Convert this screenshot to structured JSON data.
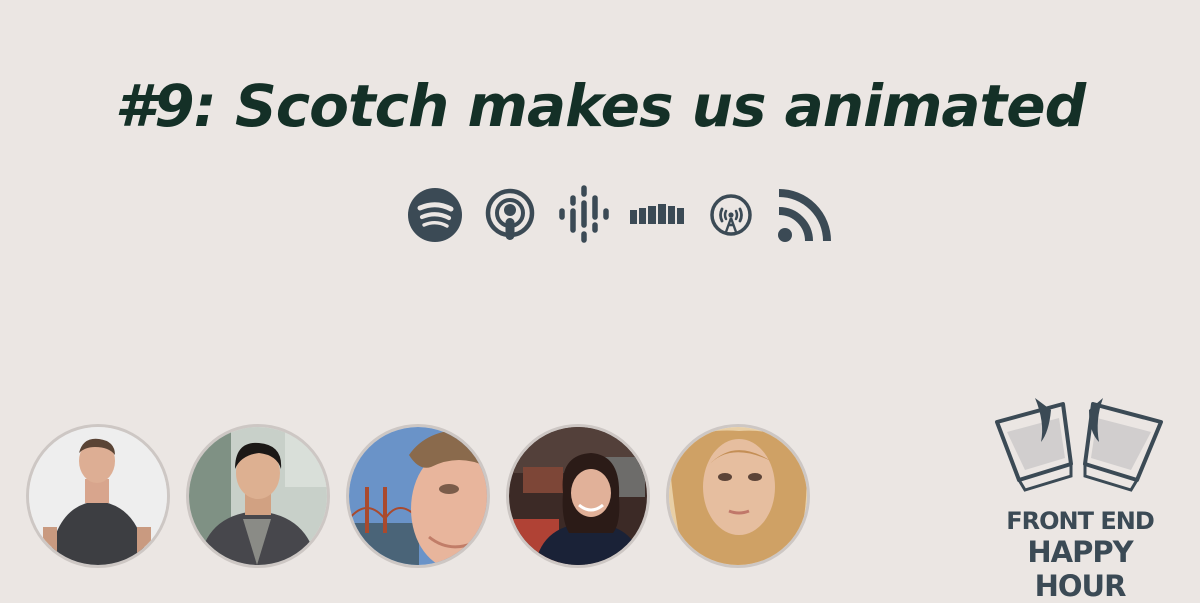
{
  "episode": {
    "title": "#9: Scotch makes us animated"
  },
  "platforms": [
    {
      "icon": "spotify-icon"
    },
    {
      "icon": "apple-podcasts-icon"
    },
    {
      "icon": "google-podcasts-icon"
    },
    {
      "icon": "castbox-icon"
    },
    {
      "icon": "overcast-icon"
    },
    {
      "icon": "rss-feed-icon"
    }
  ],
  "hosts": [
    {
      "avatar": "host-avatar-1"
    },
    {
      "avatar": "host-avatar-2"
    },
    {
      "avatar": "host-avatar-3"
    },
    {
      "avatar": "host-avatar-4"
    },
    {
      "avatar": "host-avatar-5"
    }
  ],
  "brand": {
    "line1": "FRONT END",
    "line2": "HAPPY HOUR"
  },
  "colors": {
    "background": "#ebe6e3",
    "title": "#143027",
    "icons": "#3b4a55",
    "avatar_border": "#cdc7c4"
  }
}
